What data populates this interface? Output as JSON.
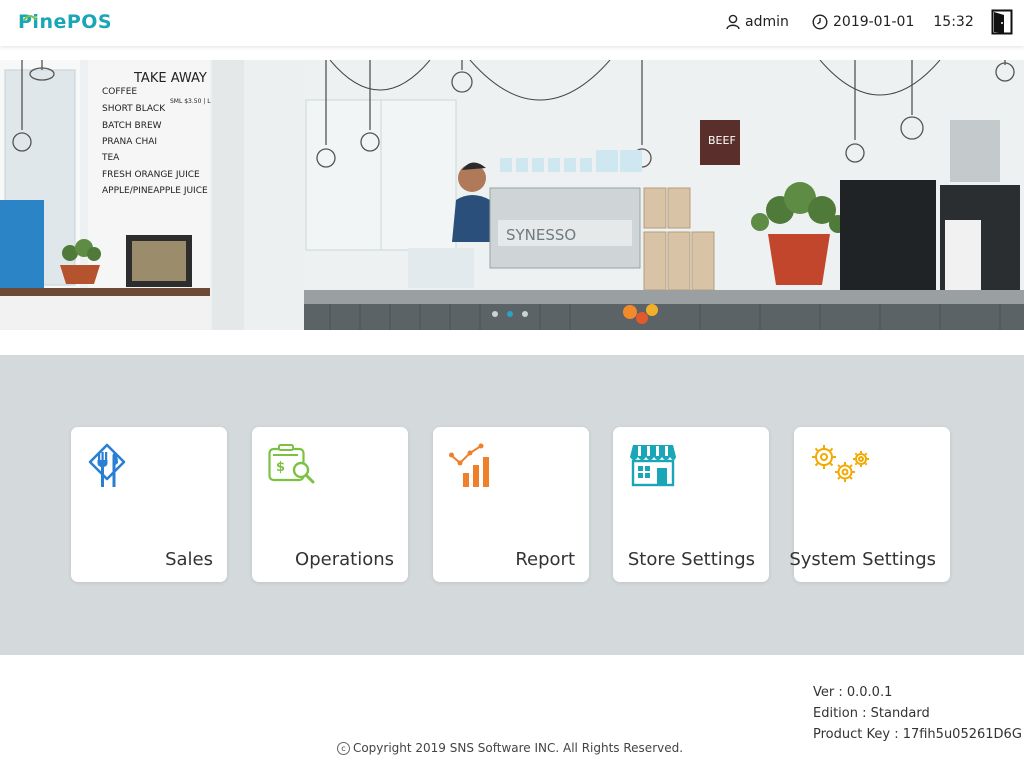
{
  "header": {
    "logo": "PinePOS",
    "user": "admin",
    "date": "2019-01-01",
    "time": "15:32"
  },
  "hero": {
    "menu_board_title": "TAKE AWAY",
    "menu_board_price": "SML $3.50 | L",
    "menu_board_items": [
      "COFFEE",
      "SHORT BLACK",
      "BATCH BREW",
      "PRANA CHAI",
      "TEA",
      "FRESH ORANGE JUICE",
      "APPLE/PINEAPPLE JUICE"
    ],
    "machine_brand": "SYNESSO",
    "sign_text": "BEEF",
    "carousel_active": 1,
    "carousel_count": 3
  },
  "menu": {
    "items": [
      {
        "label": "Sales",
        "icon": "dining-icon",
        "color": "#2a7fd4"
      },
      {
        "label": "Operations",
        "icon": "money-search-icon",
        "color": "#7cc242"
      },
      {
        "label": "Report",
        "icon": "bar-chart-icon",
        "color": "#f07f2a"
      },
      {
        "label": "Store Settings",
        "icon": "store-icon",
        "color": "#1aa6b7"
      },
      {
        "label": "System Settings",
        "icon": "gears-icon",
        "color": "#f2a900"
      }
    ]
  },
  "footer": {
    "version": "Ver : 0.0.0.1",
    "edition": "Edition : Standard",
    "product_key": "Product Key : 17fih5u05261D6G",
    "copyright": "Copyright 2019 SNS Software INC.  All Rights Reserved."
  },
  "colors": {
    "accent": "#1aa6b7",
    "panel": "#d4dadb"
  }
}
